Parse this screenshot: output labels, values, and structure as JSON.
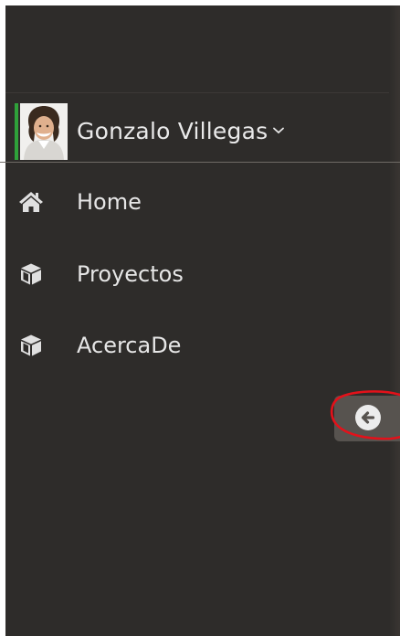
{
  "user": {
    "name": "Gonzalo Villegas",
    "accent_color": "#2fa23a",
    "avatar_icon": "user-avatar",
    "dropdown_icon": "chevron-down-icon"
  },
  "nav": {
    "items": [
      {
        "label": "Home",
        "icon": "home-icon"
      },
      {
        "label": "Proyectos",
        "icon": "cube-icon"
      },
      {
        "label": "AcercaDe",
        "icon": "cube-icon"
      }
    ]
  },
  "sidebar_toggle": {
    "icon": "arrow-circle-left-icon",
    "highlight_color": "#e3111a"
  },
  "colors": {
    "sidebar_bg": "#2e2c2a",
    "text": "#e6e6e6",
    "toggle_bg": "#57534f"
  }
}
